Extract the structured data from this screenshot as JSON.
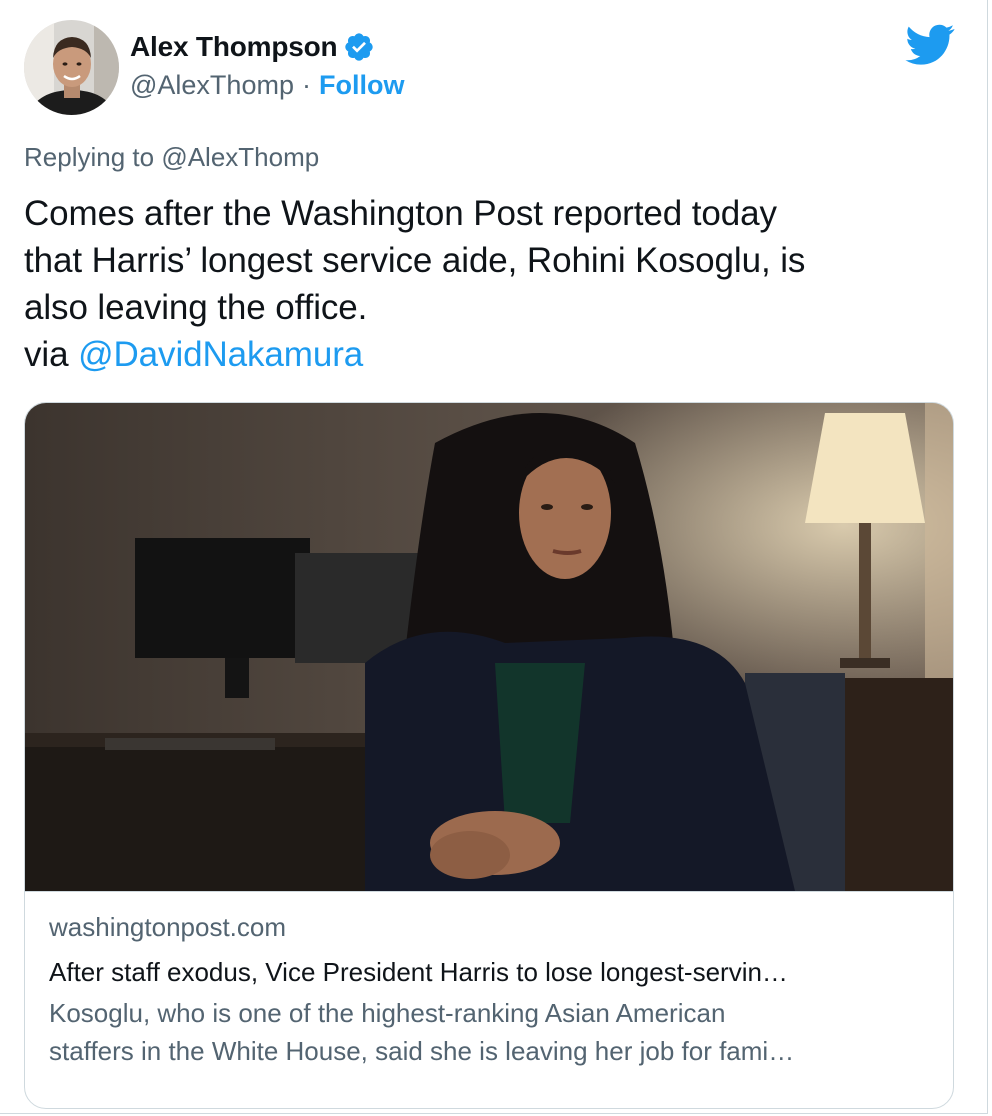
{
  "author": {
    "display_name": "Alex Thompson",
    "handle": "@AlexThomp",
    "separator": "·",
    "follow_label": "Follow",
    "verified": true
  },
  "reply": {
    "prefix": "Replying to ",
    "mention": "@AlexThomp"
  },
  "tweet": {
    "line1": "Comes after the Washington Post reported today",
    "line2": "that Harris’ longest service aide, Rohini Kosoglu, is",
    "line3": "also leaving the office.",
    "via_prefix": "via ",
    "via_mention": "@DavidNakamura"
  },
  "card": {
    "domain": "washingtonpost.com",
    "title": "After staff exodus, Vice President Harris to lose longest-servin…",
    "description_line1": "Kosoglu, who is one of the highest-ranking Asian American",
    "description_line2": "staffers in the White House, said she is leaving her job for fami…"
  },
  "icons": {
    "brand": "twitter-bird-icon",
    "verified": "verified-badge-icon"
  },
  "colors": {
    "link": "#1d9bf0",
    "secondary_text": "#536471",
    "primary_text": "#0f1419",
    "border": "#cfd9de"
  }
}
